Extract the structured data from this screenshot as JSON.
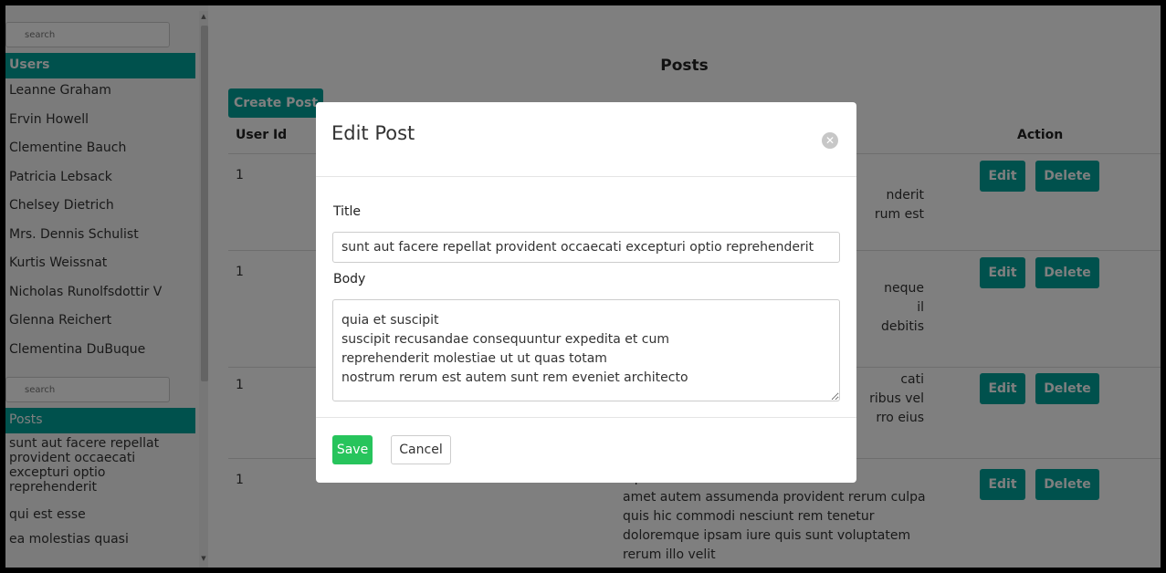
{
  "sidebar": {
    "users_search_placeholder": "search",
    "users_header": "Users",
    "users": [
      "Leanne Graham",
      "Ervin Howell",
      "Clementine Bauch",
      "Patricia Lebsack",
      "Chelsey Dietrich",
      "Mrs. Dennis Schulist",
      "Kurtis Weissnat",
      "Nicholas Runolfsdottir V",
      "Glenna Reichert",
      "Clementina DuBuque"
    ],
    "posts_search_placeholder": "search",
    "posts_header": "Posts",
    "posts": [
      "sunt aut facere repellat provident occaecati excepturi optio reprehenderit",
      "qui est esse",
      "ea molestias quasi"
    ]
  },
  "main": {
    "title": "Posts",
    "create_button": "Create Post",
    "columns": {
      "user_id": "User Id",
      "action": "Action"
    },
    "rows": [
      {
        "user_id": "1",
        "body": "nderit\nrum est"
      },
      {
        "user_id": "1",
        "body": "neque\nil\n debitis"
      },
      {
        "user_id": "1",
        "body": "cati\nribus vel\nrro eius"
      },
      {
        "user_id": "1",
        "body": "ulpisci sit\namet autem assumenda provident rerum culpa\nquis hic commodi nesciunt rem tenetur\ndoloremque ipsam iure quis sunt voluptatem\nrerum illo velit"
      }
    ],
    "edit_label": "Edit",
    "delete_label": "Delete"
  },
  "modal": {
    "title": "Edit Post",
    "title_label": "Title",
    "title_value": "sunt aut facere repellat provident occaecati excepturi optio reprehenderit",
    "body_label": "Body",
    "body_value": "quia et suscipit\nsuscipit recusandae consequuntur expedita et cum\nreprehenderit molestiae ut ut quas totam\nnostrum rerum est autem sunt rem eveniet architecto",
    "save_label": "Save",
    "cancel_label": "Cancel"
  },
  "colors": {
    "accent": "#00a29b",
    "save": "#27c45c",
    "overlay": "rgba(0,0,0,0.5)"
  }
}
